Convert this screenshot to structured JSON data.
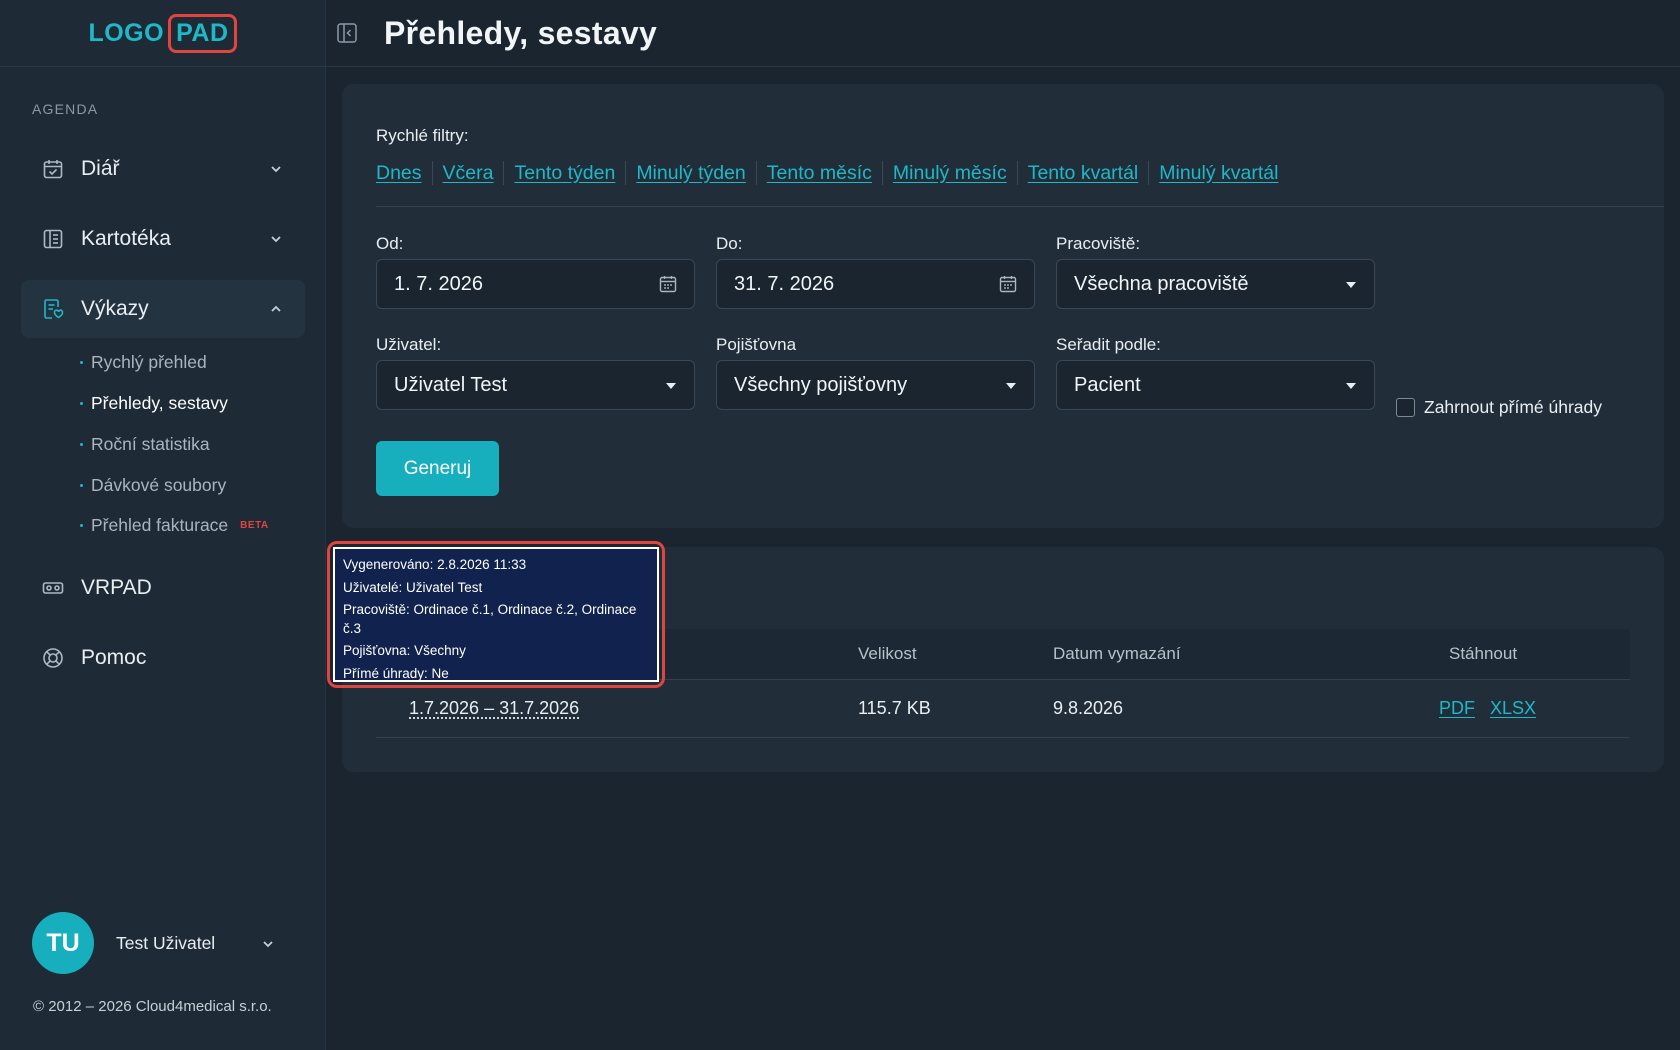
{
  "logo": {
    "part1": "LOGO",
    "part2": "PAD"
  },
  "sidebar": {
    "section_label": "AGENDA",
    "items": [
      {
        "label": "Diář",
        "icon": "calendar-check-icon"
      },
      {
        "label": "Kartotéka",
        "icon": "book-icon"
      },
      {
        "label": "Výkazy",
        "icon": "report-icon"
      },
      {
        "label": "VRPAD",
        "icon": "vr-headset-icon"
      },
      {
        "label": "Pomoc",
        "icon": "lifebuoy-icon"
      }
    ],
    "subitems": [
      {
        "label": "Rychlý přehled"
      },
      {
        "label": "Přehledy, sestavy"
      },
      {
        "label": "Roční statistika"
      },
      {
        "label": "Dávkové soubory"
      },
      {
        "label": "Přehled fakturace",
        "badge": "BETA"
      }
    ],
    "user": {
      "initials": "TU",
      "name": "Test Uživatel"
    },
    "copyright": "© 2012 – 2026 Cloud4medical s.r.o."
  },
  "header": {
    "title": "Přehledy, sestavy"
  },
  "filters": {
    "label": "Rychlé filtry:",
    "quick": [
      "Dnes",
      "Včera",
      "Tento týden",
      "Minulý týden",
      "Tento měsíc",
      "Minulý měsíc",
      "Tento kvartál",
      "Minulý kvartál"
    ],
    "from": {
      "label": "Od:",
      "value": "1. 7. 2026"
    },
    "to": {
      "label": "Do:",
      "value": "31. 7. 2026"
    },
    "workplace": {
      "label": "Pracoviště:",
      "value": "Všechna pracoviště"
    },
    "user": {
      "label": "Uživatel:",
      "value": "Uživatel Test"
    },
    "insurance": {
      "label": "Pojišťovna",
      "value": "Všechny pojišťovny"
    },
    "sort": {
      "label": "Seřadit podle:",
      "value": "Pacient"
    },
    "direct_payments": {
      "label": "Zahrnout přímé úhrady",
      "checked": false
    },
    "generate_label": "Generuj"
  },
  "table": {
    "columns": {
      "size": "Velikost",
      "deletion": "Datum vymazání",
      "download": "Stáhnout"
    },
    "rows": [
      {
        "range": "1.7.2026 – 31.7.2026",
        "size": "115.7 KB",
        "deletion": "9.8.2026",
        "pdf": "PDF",
        "xlsx": "XLSX"
      }
    ]
  },
  "tooltip": {
    "generated": "Vygenerováno: 2.8.2026 11:33",
    "users": "Uživatelé: Uživatel Test",
    "workplaces": "Pracoviště: Ordinace č.1, Ordinace č.2, Ordinace č.3",
    "insurance": "Pojišťovna: Všechny",
    "direct": "Přímé úhrady: Ne"
  },
  "colors": {
    "accent": "#1fb8c7",
    "logo_border": "#e0453f",
    "tooltip_bg": "#10224d"
  }
}
